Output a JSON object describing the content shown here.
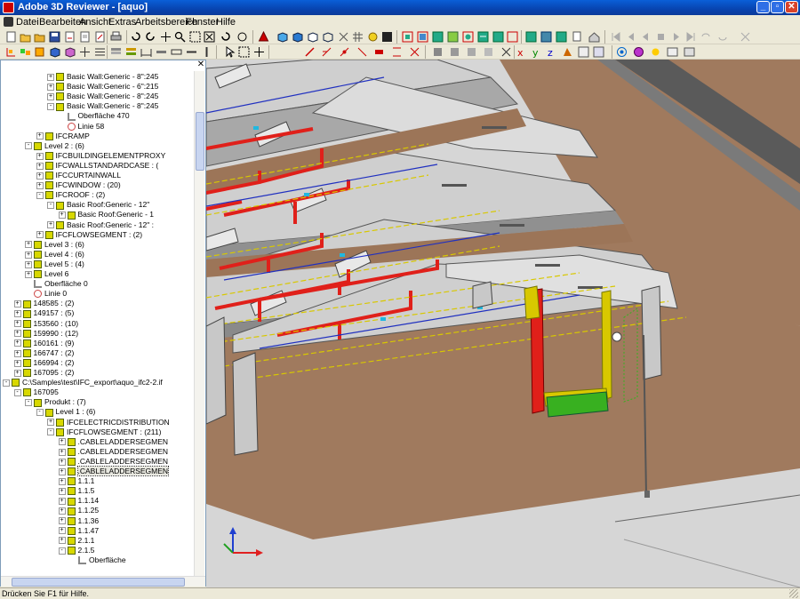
{
  "window": {
    "title": "Adobe 3D Reviewer - [aquo]"
  },
  "menubar": {
    "items": [
      "Datei",
      "Bearbeiten",
      "Ansicht",
      "Extras",
      "Arbeitsbereich",
      "Fenster",
      "Hilfe"
    ]
  },
  "tree": {
    "rows": [
      {
        "label": "Basic Wall:Generic - 8\":245",
        "indent": 5,
        "type": "node",
        "exp": "+"
      },
      {
        "label": "Basic Wall:Generic - 6\":215",
        "indent": 5,
        "type": "node",
        "exp": "+"
      },
      {
        "label": "Basic Wall:Generic - 8\":245",
        "indent": 5,
        "type": "node",
        "exp": "+"
      },
      {
        "label": "Basic Wall:Generic - 8\":245",
        "indent": 5,
        "type": "node",
        "exp": "-"
      },
      {
        "label": "Oberfläche 470",
        "indent": 6,
        "type": "surf",
        "exp": ""
      },
      {
        "label": "Linie 58",
        "indent": 6,
        "type": "line",
        "exp": ""
      },
      {
        "label": "IFCRAMP",
        "indent": 4,
        "type": "node",
        "exp": "+"
      },
      {
        "label": "Level 2 : (6)",
        "indent": 3,
        "type": "node",
        "exp": "-"
      },
      {
        "label": "IFCBUILDINGELEMENTPROXY",
        "indent": 4,
        "type": "node",
        "exp": "+"
      },
      {
        "label": "IFCWALLSTANDARDCASE : (",
        "indent": 4,
        "type": "node",
        "exp": "+"
      },
      {
        "label": "IFCCURTAINWALL",
        "indent": 4,
        "type": "node",
        "exp": "+"
      },
      {
        "label": "IFCWINDOW : (20)",
        "indent": 4,
        "type": "node",
        "exp": "+"
      },
      {
        "label": "IFCROOF : (2)",
        "indent": 4,
        "type": "node",
        "exp": "-"
      },
      {
        "label": "Basic Roof:Generic - 12\"",
        "indent": 5,
        "type": "node",
        "exp": "-"
      },
      {
        "label": "Basic Roof:Generic - 1",
        "indent": 6,
        "type": "node",
        "exp": "+"
      },
      {
        "label": "Basic Roof:Generic - 12\" :",
        "indent": 5,
        "type": "node",
        "exp": "+"
      },
      {
        "label": "IFCFLOWSEGMENT : (2)",
        "indent": 4,
        "type": "node",
        "exp": "+"
      },
      {
        "label": "Level 3 : (6)",
        "indent": 3,
        "type": "node",
        "exp": "+"
      },
      {
        "label": "Level 4 : (6)",
        "indent": 3,
        "type": "node",
        "exp": "+"
      },
      {
        "label": "Level 5 : (4)",
        "indent": 3,
        "type": "node",
        "exp": "+"
      },
      {
        "label": "Level 6",
        "indent": 3,
        "type": "node",
        "exp": "+"
      },
      {
        "label": "Oberfläche 0",
        "indent": 3,
        "type": "surf",
        "exp": ""
      },
      {
        "label": "Linie 0",
        "indent": 3,
        "type": "line",
        "exp": ""
      },
      {
        "label": "148585 : (2)",
        "indent": 2,
        "type": "node",
        "exp": "+"
      },
      {
        "label": "149157 : (5)",
        "indent": 2,
        "type": "node",
        "exp": "+"
      },
      {
        "label": "153560 : (10)",
        "indent": 2,
        "type": "node",
        "exp": "+"
      },
      {
        "label": "159990 : (12)",
        "indent": 2,
        "type": "node",
        "exp": "+"
      },
      {
        "label": "160161 : (9)",
        "indent": 2,
        "type": "node",
        "exp": "+"
      },
      {
        "label": "166747 : (2)",
        "indent": 2,
        "type": "node",
        "exp": "+"
      },
      {
        "label": "166994 : (2)",
        "indent": 2,
        "type": "node",
        "exp": "+"
      },
      {
        "label": "167095 : (2)",
        "indent": 2,
        "type": "node",
        "exp": "+"
      },
      {
        "label": "C:\\Samples\\test\\IFC_export\\aquo_ifc2-2.if",
        "indent": 1,
        "type": "node",
        "exp": "-"
      },
      {
        "label": "167095",
        "indent": 2,
        "type": "node",
        "exp": "-"
      },
      {
        "label": "Produkt : (7)",
        "indent": 3,
        "type": "node",
        "exp": "-"
      },
      {
        "label": "Level 1 : (6)",
        "indent": 4,
        "type": "node",
        "exp": "-"
      },
      {
        "label": "IFCELECTRICDISTRIBUTION",
        "indent": 5,
        "type": "node",
        "exp": "+"
      },
      {
        "label": "IFCFLOWSEGMENT : (211)",
        "indent": 5,
        "type": "node",
        "exp": "-"
      },
      {
        "label": ".CABLELADDERSEGMEN",
        "indent": 6,
        "type": "node",
        "exp": "+"
      },
      {
        "label": ".CABLELADDERSEGMEN",
        "indent": 6,
        "type": "node",
        "exp": "+"
      },
      {
        "label": ".CABLELADDERSEGMEN",
        "indent": 6,
        "type": "node",
        "exp": "+"
      },
      {
        "label": ".CABLELADDERSEGMEN",
        "indent": 6,
        "type": "node",
        "exp": "+",
        "selected": true
      },
      {
        "label": "1.1.1",
        "indent": 6,
        "type": "node",
        "exp": "+"
      },
      {
        "label": "1.1.5",
        "indent": 6,
        "type": "node",
        "exp": "+"
      },
      {
        "label": "1.1.14",
        "indent": 6,
        "type": "node",
        "exp": "+"
      },
      {
        "label": "1.1.25",
        "indent": 6,
        "type": "node",
        "exp": "+"
      },
      {
        "label": "1.1.36",
        "indent": 6,
        "type": "node",
        "exp": "+"
      },
      {
        "label": "1.1.47",
        "indent": 6,
        "type": "node",
        "exp": "+"
      },
      {
        "label": "2.1.1",
        "indent": 6,
        "type": "node",
        "exp": "+"
      },
      {
        "label": "2.1.5",
        "indent": 6,
        "type": "node",
        "exp": "-"
      },
      {
        "label": "Oberfläche",
        "indent": 7,
        "type": "surf",
        "exp": ""
      }
    ]
  },
  "statusbar": {
    "message": "Drücken Sie F1 für Hilfe."
  },
  "colors": {
    "floor": "#a07a5e",
    "roof": "#cfcfcf",
    "pipe_red": "#e0201a",
    "pipe_blue": "#2030c0",
    "cable_yellow": "#d8c800",
    "unit_green": "#38b020",
    "ground": "#d4d4d4"
  },
  "icons": {
    "tree_close": "close-icon",
    "axis_gizmo": "axis-gizmo-icon"
  }
}
